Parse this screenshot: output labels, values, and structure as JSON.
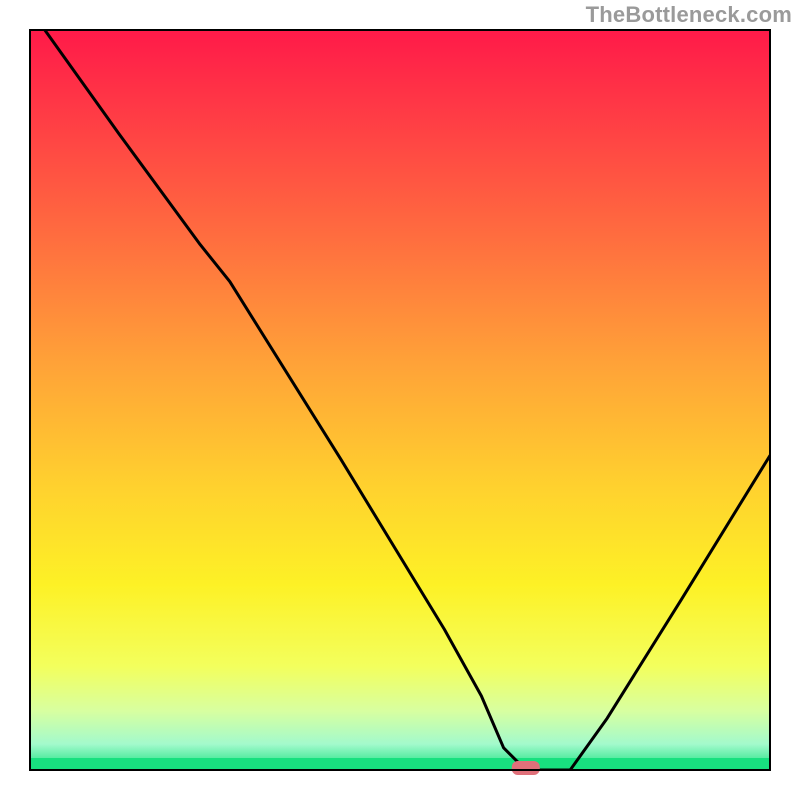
{
  "watermark": {
    "text": "TheBottleneck.com"
  },
  "chart_data": {
    "type": "line",
    "title": "",
    "xlabel": "",
    "ylabel": "",
    "xlim": [
      0,
      100
    ],
    "ylim": [
      0,
      100
    ],
    "grid": false,
    "legend": false,
    "background_gradient_stops": [
      {
        "offset": 0.0,
        "color": "#ff1a49"
      },
      {
        "offset": 0.12,
        "color": "#ff3d45"
      },
      {
        "offset": 0.28,
        "color": "#ff6d3f"
      },
      {
        "offset": 0.45,
        "color": "#ffa238"
      },
      {
        "offset": 0.62,
        "color": "#ffd22e"
      },
      {
        "offset": 0.75,
        "color": "#fdf126"
      },
      {
        "offset": 0.86,
        "color": "#f3ff5d"
      },
      {
        "offset": 0.92,
        "color": "#d8ffa0"
      },
      {
        "offset": 0.965,
        "color": "#a3facc"
      },
      {
        "offset": 1.0,
        "color": "#18e07f"
      }
    ],
    "series": [
      {
        "name": "bottleneck-curve",
        "x": [
          2.0,
          12.0,
          23.0,
          27.0,
          42.0,
          56.0,
          61.0,
          64.0,
          67.0,
          73.0,
          78.0,
          88.0,
          100.0
        ],
        "values": [
          100.0,
          86.0,
          71.0,
          66.0,
          42.0,
          19.0,
          10.0,
          3.0,
          0.0,
          0.0,
          7.0,
          23.0,
          42.5
        ]
      }
    ],
    "marker": {
      "name": "optimal-region",
      "x_center": 67.0,
      "y": 0.0,
      "color": "#e0707a"
    }
  }
}
